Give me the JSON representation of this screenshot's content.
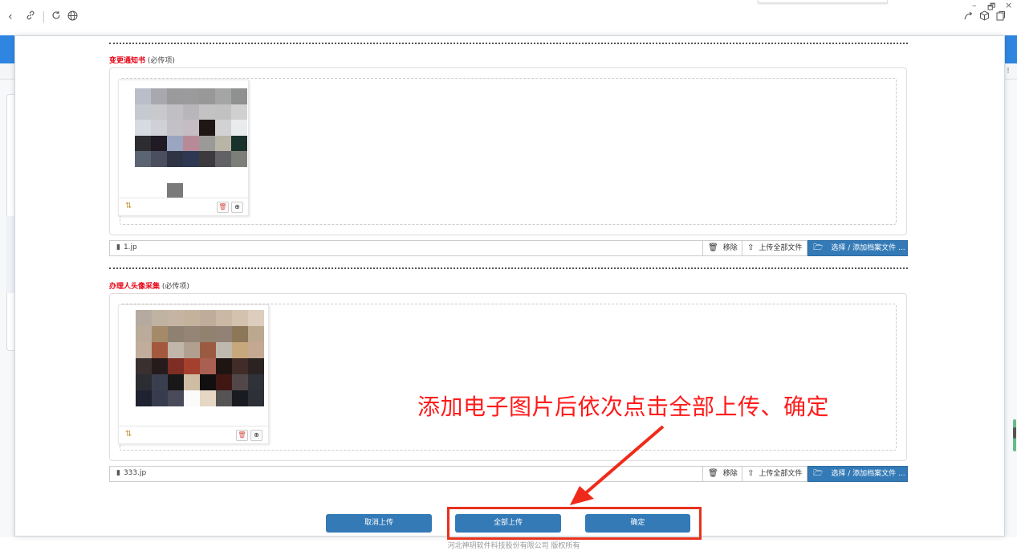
{
  "browser": {
    "nav_icons": [
      "back-icon",
      "link-icon",
      "refresh-icon",
      "globe-icon"
    ],
    "right_icons": [
      "share-icon",
      "box-icon",
      "extension-icon"
    ],
    "window": {
      "minimize": "–",
      "restore": "🗗",
      "close": "×"
    }
  },
  "background": {
    "alert": "!"
  },
  "sections": [
    {
      "title": "变更通知书",
      "note": "(必传项)",
      "file_name": "1.jp",
      "remove_label": "移除",
      "upload_all_label": "上传全部文件",
      "select_label": "选择 / 添加档案文件 ..."
    },
    {
      "title": "办理人头像采集",
      "note": "(必传项)",
      "file_name": "333.jp",
      "remove_label": "移除",
      "upload_all_label": "上传全部文件",
      "select_label": "选择 / 添加档案文件 ..."
    }
  ],
  "actions": {
    "cancel": "取消上传",
    "upload_all": "全部上传",
    "confirm": "确定"
  },
  "annotation": "添加电子图片后依次点击全部上传、确定",
  "footer": "河北神玥软件科技股份有限公司 版权所有",
  "colors": {
    "primary": "#337ab7",
    "required": "#e60012",
    "annotation": "#ff1a1a",
    "highlight_box": "#e8321e"
  }
}
